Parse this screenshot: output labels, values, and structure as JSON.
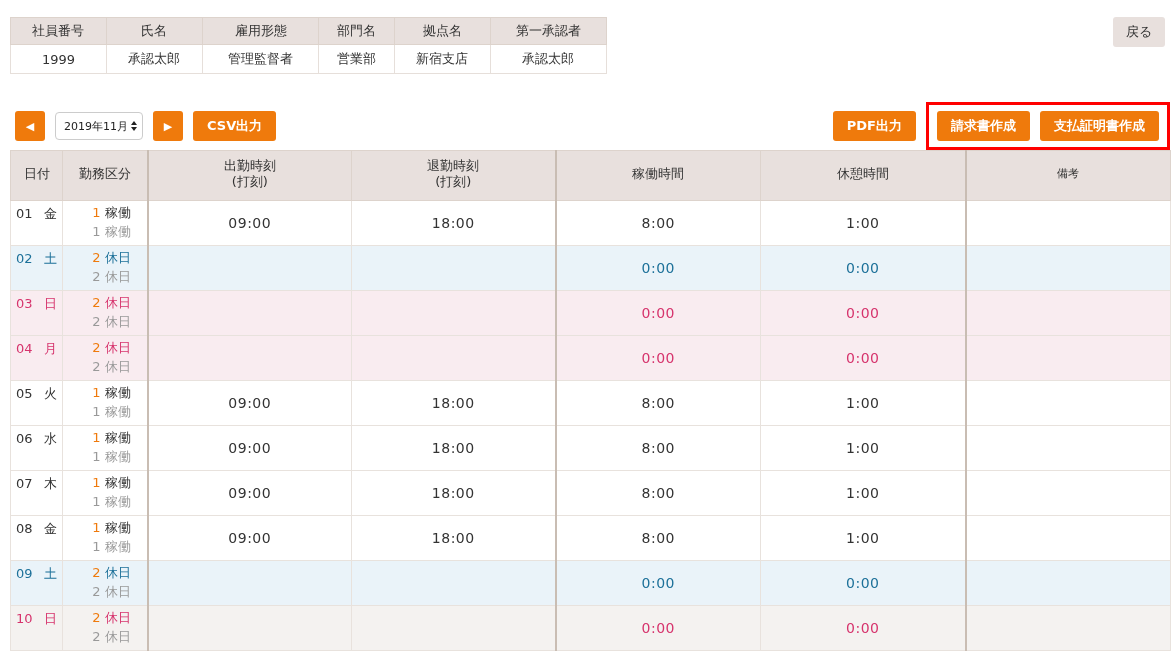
{
  "employee_table": {
    "columns": [
      "社員番号",
      "氏名",
      "雇用形態",
      "部門名",
      "拠点名",
      "第一承認者"
    ],
    "row": [
      "1999",
      "承認太郎",
      "管理監督者",
      "営業部",
      "新宿支店",
      "承認太郎"
    ]
  },
  "back_button": "戻る",
  "toolbar": {
    "prev": "◀",
    "month": "2019年11月",
    "next": "▶",
    "csv": "CSV出力",
    "pdf": "PDF出力",
    "framed_group": {
      "framed": true,
      "buttons": [
        "請求書作成",
        "支払証明書作成"
      ]
    }
  },
  "attendance": {
    "columns": [
      {
        "label": "日付"
      },
      {
        "label": "勤務区分"
      },
      {
        "label": "出勤時刻",
        "sub": "(打刻)"
      },
      {
        "label": "退勤時刻",
        "sub": "(打刻)"
      },
      {
        "label": "稼働時間"
      },
      {
        "label": "休憩時間"
      },
      {
        "label": "備考",
        "small": true
      }
    ],
    "rows": [
      {
        "kind": "workday",
        "date": "01",
        "weekday": "金",
        "plan_code": "1",
        "plan_type": "稼働",
        "actual_code": "1",
        "actual_type": "稼働",
        "clock_in": "09:00",
        "clock_out": "18:00",
        "work_time": "8:00",
        "break_time": "1:00"
      },
      {
        "kind": "saturday",
        "date": "02",
        "weekday": "土",
        "plan_code": "2",
        "plan_type": "休日",
        "actual_code": "2",
        "actual_type": "休日",
        "work_time": "0:00",
        "break_time": "0:00"
      },
      {
        "kind": "holiday",
        "date": "03",
        "weekday": "日",
        "plan_code": "2",
        "plan_type": "休日",
        "actual_code": "2",
        "actual_type": "休日",
        "work_time": "0:00",
        "break_time": "0:00"
      },
      {
        "kind": "holiday",
        "date": "04",
        "weekday": "月",
        "plan_code": "2",
        "plan_type": "休日",
        "actual_code": "2",
        "actual_type": "休日",
        "work_time": "0:00",
        "break_time": "0:00"
      },
      {
        "kind": "workday",
        "date": "05",
        "weekday": "火",
        "plan_code": "1",
        "plan_type": "稼働",
        "actual_code": "1",
        "actual_type": "稼働",
        "clock_in": "09:00",
        "clock_out": "18:00",
        "work_time": "8:00",
        "break_time": "1:00"
      },
      {
        "kind": "workday",
        "date": "06",
        "weekday": "水",
        "plan_code": "1",
        "plan_type": "稼働",
        "actual_code": "1",
        "actual_type": "稼働",
        "clock_in": "09:00",
        "clock_out": "18:00",
        "work_time": "8:00",
        "break_time": "1:00"
      },
      {
        "kind": "workday",
        "date": "07",
        "weekday": "木",
        "plan_code": "1",
        "plan_type": "稼働",
        "actual_code": "1",
        "actual_type": "稼働",
        "clock_in": "09:00",
        "clock_out": "18:00",
        "work_time": "8:00",
        "break_time": "1:00"
      },
      {
        "kind": "workday",
        "date": "08",
        "weekday": "金",
        "plan_code": "1",
        "plan_type": "稼働",
        "actual_code": "1",
        "actual_type": "稼働",
        "clock_in": "09:00",
        "clock_out": "18:00",
        "work_time": "8:00",
        "break_time": "1:00"
      },
      {
        "kind": "saturday",
        "date": "09",
        "weekday": "土",
        "plan_code": "2",
        "plan_type": "休日",
        "actual_code": "2",
        "actual_type": "休日",
        "work_time": "0:00",
        "break_time": "0:00"
      },
      {
        "kind": "sunday",
        "date": "10",
        "weekday": "日",
        "plan_code": "2",
        "plan_type": "休日",
        "actual_code": "2",
        "actual_type": "休日",
        "work_time": "0:00",
        "break_time": "0:00"
      }
    ]
  }
}
